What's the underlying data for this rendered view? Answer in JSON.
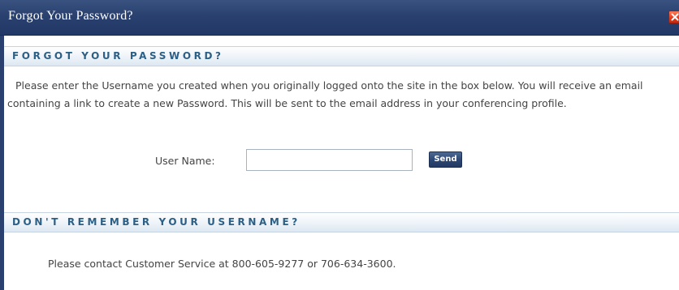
{
  "dialog": {
    "title": "Forgot Your Password?",
    "close_icon": "close-icon"
  },
  "forgot_section": {
    "header": "FORGOT YOUR PASSWORD?",
    "instructions": "Please enter the Username you created when you originally logged onto the site in the box below. You will receive an email containing a link to create a new Password. This will be sent to the email address in your conferencing profile.",
    "username_label": "User Name:",
    "username_value": "",
    "username_placeholder": "",
    "send_label": "Send"
  },
  "username_section": {
    "header": "DON'T REMEMBER YOUR USERNAME?",
    "contact_text": "Please contact Customer Service at 800-605-9277 or 706-634-3600."
  },
  "colors": {
    "titlebar": "#2a4170",
    "section_header_text": "#2c5f86",
    "close_button": "#e23a1b",
    "send_button": "#2c4673"
  }
}
